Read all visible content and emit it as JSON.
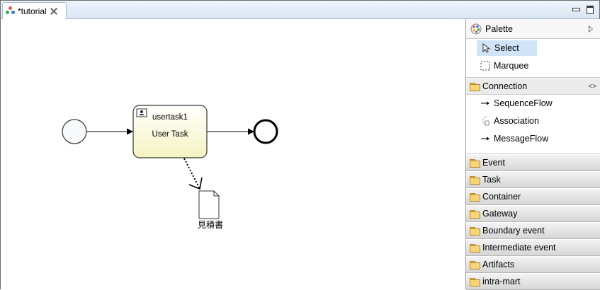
{
  "editor_tab": {
    "title": "*tutorial"
  },
  "diagram": {
    "task": {
      "id_label": "usertask1",
      "name": "User Task"
    },
    "document": {
      "label": "見積書"
    }
  },
  "palette": {
    "title": "Palette",
    "tools": [
      {
        "label": "Select",
        "selected": true
      },
      {
        "label": "Marquee",
        "selected": false
      }
    ],
    "connection_drawer": {
      "label": "Connection",
      "items": [
        "SequenceFlow",
        "Association",
        "MessageFlow"
      ]
    },
    "drawers": [
      "Event",
      "Task",
      "Container",
      "Gateway",
      "Boundary event",
      "Intermediate event",
      "Artifacts",
      "intra-mart"
    ]
  },
  "colors": {
    "task_fill_top": "#ffffff",
    "task_fill_bottom": "#f4f3c0",
    "selection_highlight": "#cfe3f9",
    "tab_bar": "#dbe6f3"
  }
}
